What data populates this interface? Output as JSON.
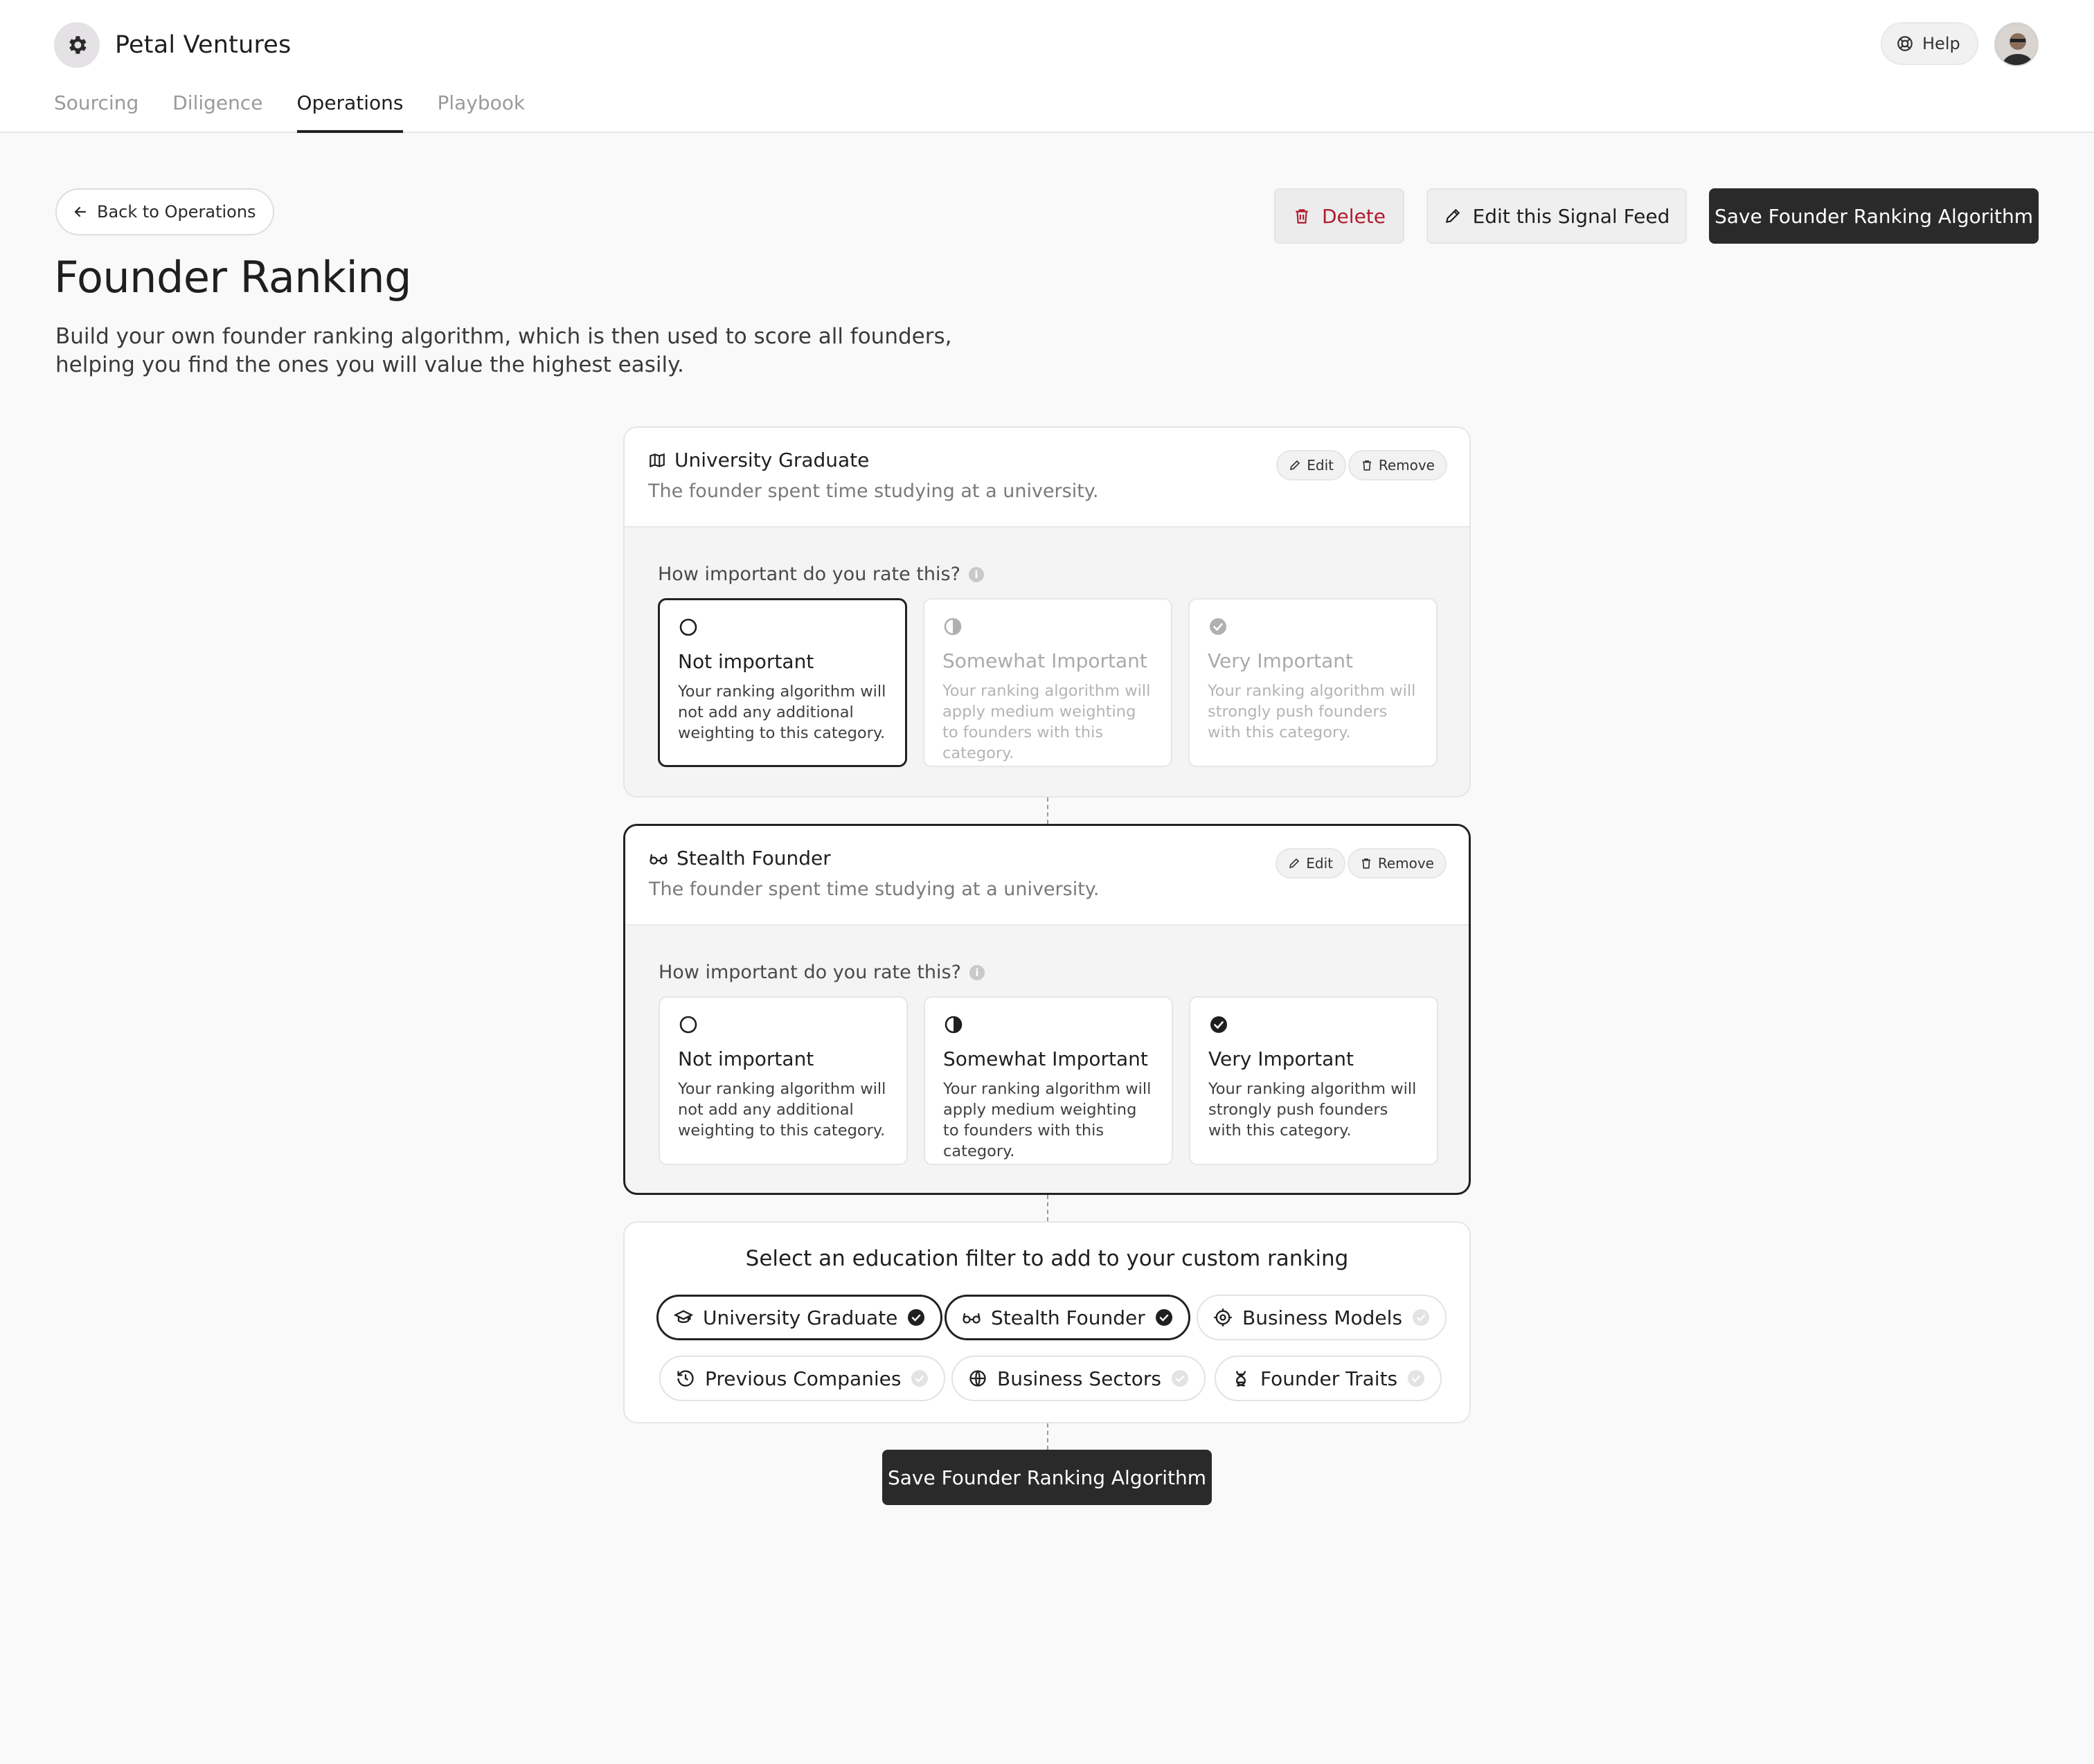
{
  "brand": {
    "name": "Petal Ventures"
  },
  "header": {
    "help_label": "Help",
    "tabs": [
      {
        "label": "Sourcing"
      },
      {
        "label": "Diligence"
      },
      {
        "label": "Operations"
      },
      {
        "label": "Playbook"
      }
    ],
    "active_tab": "Operations"
  },
  "page": {
    "back_label": "Back to Operations",
    "delete_label": "Delete",
    "edit_label": "Edit this Signal Feed",
    "save_label": "Save Founder Ranking Algorithm",
    "title": "Founder Ranking",
    "description": "Build your own founder ranking algorithm, which is then used to score all founders, helping you find the ones you will value the highest easily."
  },
  "cards": [
    {
      "title": "University Graduate",
      "icon": "map-icon",
      "subtitle": "The founder spent time studying at a university.",
      "edit_label": "Edit",
      "remove_label": "Remove",
      "question": "How important do you rate this?",
      "selected_option": "Not important",
      "options": [
        {
          "title": "Not important",
          "desc": "Your ranking algorithm will not add any additional weighting to this category."
        },
        {
          "title": "Somewhat Important",
          "desc": "Your ranking algorithm will apply medium weighting to founders with this category."
        },
        {
          "title": "Very Important",
          "desc": "Your ranking algorithm will strongly push founders with this category."
        }
      ]
    },
    {
      "title": "Stealth Founder",
      "icon": "glasses-icon",
      "subtitle": "The founder spent time studying at a university.",
      "edit_label": "Edit",
      "remove_label": "Remove",
      "question": "How important do you rate this?",
      "selected_option": null,
      "options": [
        {
          "title": "Not important",
          "desc": "Your ranking algorithm will not add any additional weighting to this category."
        },
        {
          "title": "Somewhat Important",
          "desc": "Your ranking algorithm will apply medium weighting to founders with this category."
        },
        {
          "title": "Very Important",
          "desc": "Your ranking algorithm will strongly push founders with this category."
        }
      ]
    }
  ],
  "filters": {
    "title": "Select an education filter to add to your custom ranking",
    "items": [
      {
        "label": "University Graduate",
        "icon": "graduation-cap-icon",
        "selected": true
      },
      {
        "label": "Stealth Founder",
        "icon": "glasses-icon",
        "selected": true
      },
      {
        "label": "Business Models",
        "icon": "target-icon",
        "selected": false
      },
      {
        "label": "Previous Companies",
        "icon": "history-icon",
        "selected": false
      },
      {
        "label": "Business Sectors",
        "icon": "globe-icon",
        "selected": false
      },
      {
        "label": "Founder Traits",
        "icon": "dna-icon",
        "selected": false
      }
    ]
  },
  "bottom": {
    "save_label": "Save Founder Ranking Algorithm"
  },
  "colors": {
    "primary": "#2a2a2a",
    "danger": "#b01c2e",
    "muted": "#9a9a9a",
    "background": "#f9f9f9"
  }
}
